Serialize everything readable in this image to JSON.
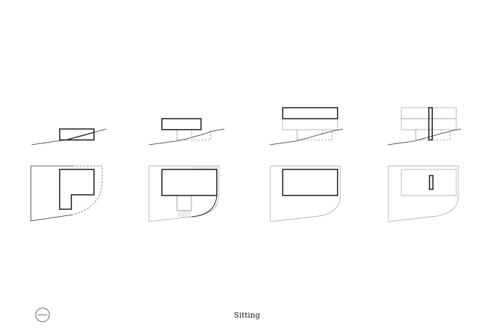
{
  "figure": {
    "caption": "Sitting"
  },
  "colors": {
    "background": "#ffffff",
    "bold_line": "#111111",
    "thin_line": "#222222",
    "light_line": "#9a9a9a",
    "dashed_line": "#555555"
  },
  "panels": [
    {
      "id": "stage-1"
    },
    {
      "id": "stage-2"
    },
    {
      "id": "stage-3"
    },
    {
      "id": "stage-4"
    }
  ]
}
